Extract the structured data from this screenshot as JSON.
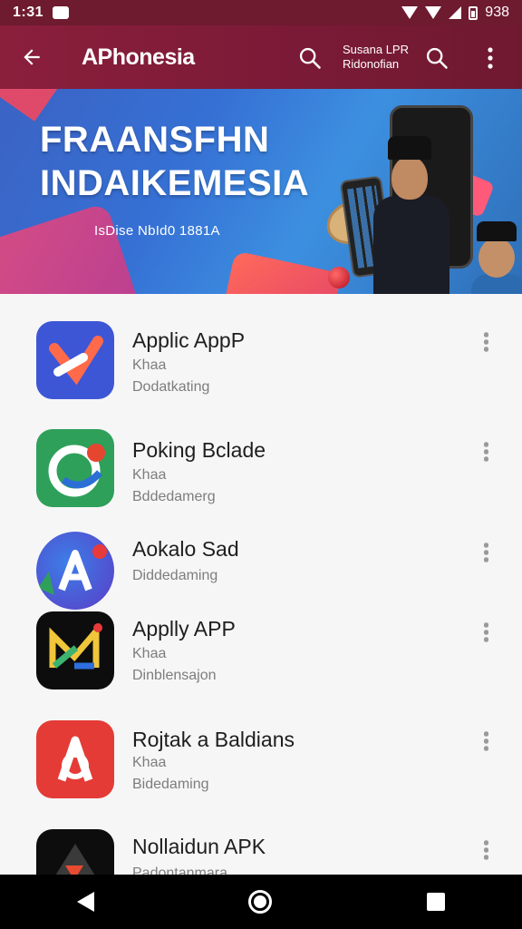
{
  "status_bar": {
    "time": "1:31",
    "battery": "938"
  },
  "app_bar": {
    "title": "APhonesia",
    "subtitle_line1": "Susana LPR",
    "subtitle_line2": "Ridonofian"
  },
  "banner": {
    "title_line1": "FRAANSFHN",
    "title_line2": "INDAIKEMESIA",
    "subtitle": "IsDise NbId0 1881A"
  },
  "apps": [
    {
      "name": "Applic AppP",
      "category": "Khaa",
      "detail": "Dodatkating",
      "icon": "app-icon-blue-x"
    },
    {
      "name": "Poking Bclade",
      "category": "Khaa",
      "detail": "Bddedamerg",
      "icon": "app-icon-green-swirl"
    },
    {
      "name": "Aokalo Sad",
      "category": "",
      "detail": "Diddedaming",
      "icon": "app-icon-blue-a"
    },
    {
      "name": "Applly APP",
      "category": "Khaa",
      "detail": "Dinblensajon",
      "icon": "app-icon-black-m"
    },
    {
      "name": "Rojtak a Baldians",
      "category": "Khaa",
      "detail": "Bidedaming",
      "icon": "app-icon-red-a"
    },
    {
      "name": "Nollaidun APK",
      "category": "",
      "detail": "Padontanmara",
      "icon": "app-icon-black-triangle"
    }
  ],
  "colors": {
    "app_bar": "#8a1f3c",
    "status_bar": "#6e1a2f",
    "banner": "#3670d4"
  }
}
